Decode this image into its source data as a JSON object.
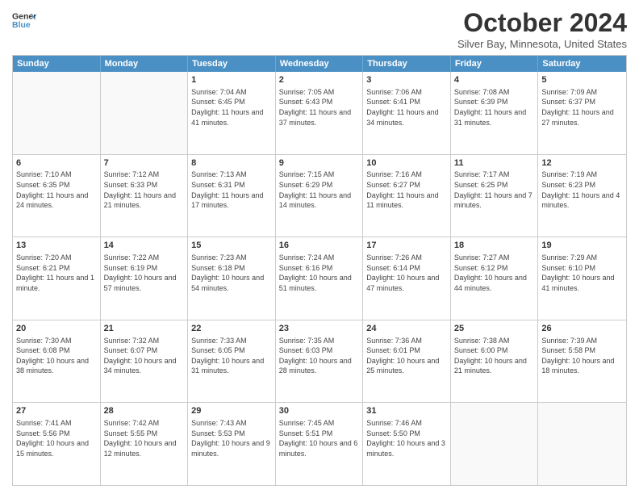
{
  "header": {
    "logo_line1": "General",
    "logo_line2": "Blue",
    "month": "October 2024",
    "location": "Silver Bay, Minnesota, United States"
  },
  "weekdays": [
    "Sunday",
    "Monday",
    "Tuesday",
    "Wednesday",
    "Thursday",
    "Friday",
    "Saturday"
  ],
  "rows": [
    [
      {
        "day": "",
        "text": "",
        "empty": true
      },
      {
        "day": "",
        "text": "",
        "empty": true
      },
      {
        "day": "1",
        "text": "Sunrise: 7:04 AM\nSunset: 6:45 PM\nDaylight: 11 hours and 41 minutes."
      },
      {
        "day": "2",
        "text": "Sunrise: 7:05 AM\nSunset: 6:43 PM\nDaylight: 11 hours and 37 minutes."
      },
      {
        "day": "3",
        "text": "Sunrise: 7:06 AM\nSunset: 6:41 PM\nDaylight: 11 hours and 34 minutes."
      },
      {
        "day": "4",
        "text": "Sunrise: 7:08 AM\nSunset: 6:39 PM\nDaylight: 11 hours and 31 minutes."
      },
      {
        "day": "5",
        "text": "Sunrise: 7:09 AM\nSunset: 6:37 PM\nDaylight: 11 hours and 27 minutes."
      }
    ],
    [
      {
        "day": "6",
        "text": "Sunrise: 7:10 AM\nSunset: 6:35 PM\nDaylight: 11 hours and 24 minutes."
      },
      {
        "day": "7",
        "text": "Sunrise: 7:12 AM\nSunset: 6:33 PM\nDaylight: 11 hours and 21 minutes."
      },
      {
        "day": "8",
        "text": "Sunrise: 7:13 AM\nSunset: 6:31 PM\nDaylight: 11 hours and 17 minutes."
      },
      {
        "day": "9",
        "text": "Sunrise: 7:15 AM\nSunset: 6:29 PM\nDaylight: 11 hours and 14 minutes."
      },
      {
        "day": "10",
        "text": "Sunrise: 7:16 AM\nSunset: 6:27 PM\nDaylight: 11 hours and 11 minutes."
      },
      {
        "day": "11",
        "text": "Sunrise: 7:17 AM\nSunset: 6:25 PM\nDaylight: 11 hours and 7 minutes."
      },
      {
        "day": "12",
        "text": "Sunrise: 7:19 AM\nSunset: 6:23 PM\nDaylight: 11 hours and 4 minutes."
      }
    ],
    [
      {
        "day": "13",
        "text": "Sunrise: 7:20 AM\nSunset: 6:21 PM\nDaylight: 11 hours and 1 minute."
      },
      {
        "day": "14",
        "text": "Sunrise: 7:22 AM\nSunset: 6:19 PM\nDaylight: 10 hours and 57 minutes."
      },
      {
        "day": "15",
        "text": "Sunrise: 7:23 AM\nSunset: 6:18 PM\nDaylight: 10 hours and 54 minutes."
      },
      {
        "day": "16",
        "text": "Sunrise: 7:24 AM\nSunset: 6:16 PM\nDaylight: 10 hours and 51 minutes."
      },
      {
        "day": "17",
        "text": "Sunrise: 7:26 AM\nSunset: 6:14 PM\nDaylight: 10 hours and 47 minutes."
      },
      {
        "day": "18",
        "text": "Sunrise: 7:27 AM\nSunset: 6:12 PM\nDaylight: 10 hours and 44 minutes."
      },
      {
        "day": "19",
        "text": "Sunrise: 7:29 AM\nSunset: 6:10 PM\nDaylight: 10 hours and 41 minutes."
      }
    ],
    [
      {
        "day": "20",
        "text": "Sunrise: 7:30 AM\nSunset: 6:08 PM\nDaylight: 10 hours and 38 minutes."
      },
      {
        "day": "21",
        "text": "Sunrise: 7:32 AM\nSunset: 6:07 PM\nDaylight: 10 hours and 34 minutes."
      },
      {
        "day": "22",
        "text": "Sunrise: 7:33 AM\nSunset: 6:05 PM\nDaylight: 10 hours and 31 minutes."
      },
      {
        "day": "23",
        "text": "Sunrise: 7:35 AM\nSunset: 6:03 PM\nDaylight: 10 hours and 28 minutes."
      },
      {
        "day": "24",
        "text": "Sunrise: 7:36 AM\nSunset: 6:01 PM\nDaylight: 10 hours and 25 minutes."
      },
      {
        "day": "25",
        "text": "Sunrise: 7:38 AM\nSunset: 6:00 PM\nDaylight: 10 hours and 21 minutes."
      },
      {
        "day": "26",
        "text": "Sunrise: 7:39 AM\nSunset: 5:58 PM\nDaylight: 10 hours and 18 minutes."
      }
    ],
    [
      {
        "day": "27",
        "text": "Sunrise: 7:41 AM\nSunset: 5:56 PM\nDaylight: 10 hours and 15 minutes."
      },
      {
        "day": "28",
        "text": "Sunrise: 7:42 AM\nSunset: 5:55 PM\nDaylight: 10 hours and 12 minutes."
      },
      {
        "day": "29",
        "text": "Sunrise: 7:43 AM\nSunset: 5:53 PM\nDaylight: 10 hours and 9 minutes."
      },
      {
        "day": "30",
        "text": "Sunrise: 7:45 AM\nSunset: 5:51 PM\nDaylight: 10 hours and 6 minutes."
      },
      {
        "day": "31",
        "text": "Sunrise: 7:46 AM\nSunset: 5:50 PM\nDaylight: 10 hours and 3 minutes."
      },
      {
        "day": "",
        "text": "",
        "empty": true
      },
      {
        "day": "",
        "text": "",
        "empty": true
      }
    ]
  ]
}
